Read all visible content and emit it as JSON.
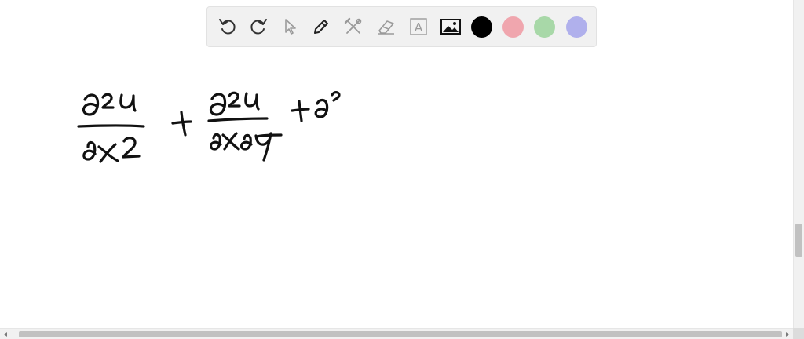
{
  "toolbar": {
    "tools": [
      {
        "icon": "undo-icon"
      },
      {
        "icon": "redo-icon"
      },
      {
        "icon": "pointer-icon"
      },
      {
        "icon": "pen-icon"
      },
      {
        "icon": "tools-icon"
      },
      {
        "icon": "eraser-icon"
      },
      {
        "icon": "text-icon",
        "glyph": "A"
      },
      {
        "icon": "image-icon"
      }
    ],
    "colors": [
      {
        "name": "black",
        "hex": "#000000"
      },
      {
        "name": "red",
        "hex": "#f0a6ae"
      },
      {
        "name": "green",
        "hex": "#a8d8a8"
      },
      {
        "name": "blue",
        "hex": "#b0b0ec"
      }
    ]
  },
  "whiteboard": {
    "ink_color": "#111111"
  }
}
